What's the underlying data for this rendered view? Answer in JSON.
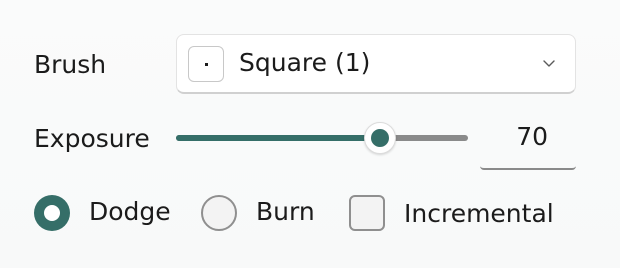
{
  "brush": {
    "label": "Brush",
    "selected": "Square (1)"
  },
  "exposure": {
    "label": "Exposure",
    "value": "70",
    "min": 0,
    "max": 100,
    "level": 70
  },
  "options": {
    "dodge_label": "Dodge",
    "burn_label": "Burn",
    "incremental_label": "Incremental",
    "mode_selected": "Dodge",
    "incremental_checked": false
  },
  "colors": {
    "accent": "#356e68",
    "track": "#8a8a8a",
    "text": "#1b1b1b"
  },
  "icons": {
    "brush_preview": "square-brush-icon",
    "dropdown": "chevron-down-icon"
  }
}
